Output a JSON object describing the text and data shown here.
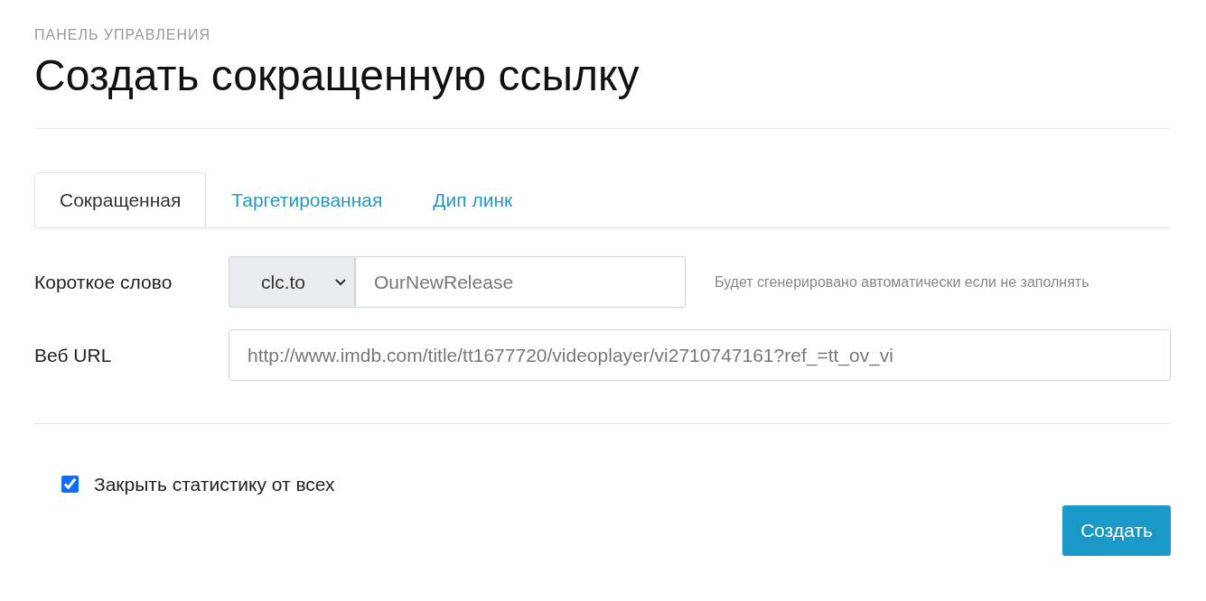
{
  "breadcrumb": "ПАНЕЛЬ УПРАВЛЕНИЯ",
  "title": "Создать сокращенную ссылку",
  "tabs": [
    {
      "label": "Сокращенная",
      "selected": true
    },
    {
      "label": "Таргетированная",
      "selected": false
    },
    {
      "label": "Дип линк",
      "selected": false
    }
  ],
  "short_word": {
    "label": "Короткое слово",
    "domain": "clc.to",
    "placeholder": "OurNewRelease",
    "hint": "Будет сгенерировано автоматически если не заполнять"
  },
  "web_url": {
    "label": "Веб URL",
    "placeholder": "http://www.imdb.com/title/tt1677720/videoplayer/vi2710747161?ref_=tt_ov_vi"
  },
  "hide_stats": {
    "label": "Закрыть статистику от всех",
    "checked": true
  },
  "submit": "Создать"
}
